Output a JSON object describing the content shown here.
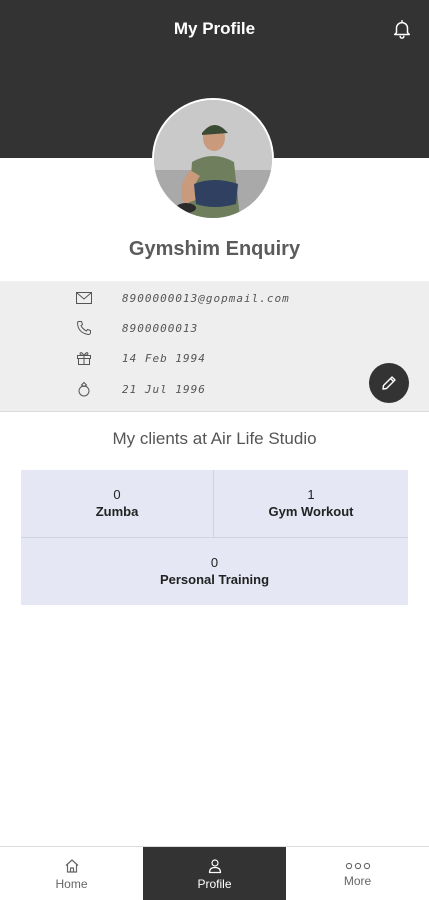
{
  "header": {
    "title": "My Profile",
    "bell_icon": "bell-icon",
    "background": "#333333"
  },
  "profile": {
    "name": "Gymshim Enquiry",
    "email": "8900000013@gopmail.com",
    "phone": "8900000013",
    "birthday": "14 Feb 1994",
    "anniversary": "21 Jul 1996",
    "icons": [
      "mail-icon",
      "phone-icon",
      "gift-icon",
      "ring-icon"
    ],
    "edit_icon": "pencil-icon"
  },
  "clients": {
    "title": "My clients at Air Life Studio",
    "cells": [
      {
        "count": "0",
        "label": "Zumba"
      },
      {
        "count": "1",
        "label": "Gym Workout"
      },
      {
        "count": "0",
        "label": "Personal Training"
      }
    ],
    "background": "#e5e8f4"
  },
  "nav": {
    "items": [
      {
        "label": "Home",
        "icon": "home-icon"
      },
      {
        "label": "Profile",
        "icon": "user-icon"
      },
      {
        "label": "More",
        "icon": "more-dots-icon"
      }
    ],
    "active_index": 1
  }
}
